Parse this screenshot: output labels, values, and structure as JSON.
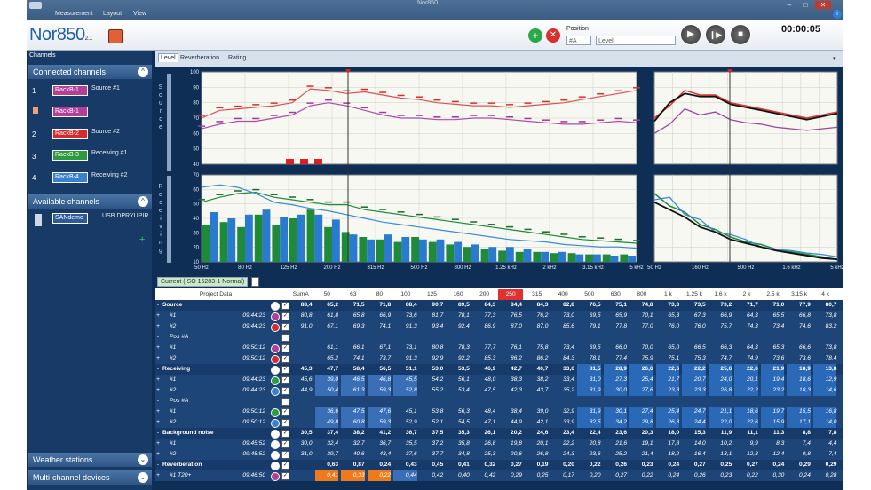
{
  "app": {
    "title": "Nor850",
    "version": "2.1",
    "window_title": "Nor850",
    "menu": [
      "Measurement",
      "Layout",
      "View"
    ],
    "timer": "00:00:05"
  },
  "toolbar": {
    "position_label": "Position",
    "position_value": "#A",
    "level_value": "Level"
  },
  "sidebar": {
    "title": "Channels",
    "connected_header": "Connected channels",
    "channels": [
      {
        "num": "1",
        "chip": "RackB-1",
        "label": "Source #1",
        "color": "#b0409a"
      },
      {
        "num": "",
        "chip": "RackB-1",
        "label": "",
        "color": "#b0409a"
      },
      {
        "num": "2",
        "chip": "RackB-2",
        "label": "Source #2",
        "color": "#d42a2a"
      },
      {
        "num": "3",
        "chip": "RackB-3",
        "label": "Receiving #1",
        "color": "#2e9a3e"
      },
      {
        "num": "4",
        "chip": "RackB-4",
        "label": "Receiving #2",
        "color": "#3a80d0"
      }
    ],
    "available_header": "Available channels",
    "available": [
      {
        "chip": "SANdemo",
        "label": "USB DPRYUPIR"
      }
    ],
    "weather_header": "Weather stations",
    "multi_header": "Multi-channel devices"
  },
  "main_tabs": [
    "Level",
    "Reverberation",
    "Rating"
  ],
  "plots": {
    "source_label": [
      "S",
      "o",
      "u",
      "r",
      "c",
      "e"
    ],
    "receiving_label": [
      "R",
      "e",
      "c",
      "e",
      "i",
      "v",
      "i",
      "n",
      "g"
    ],
    "top_y_ticks": [
      "100",
      "90",
      "80",
      "70",
      "60",
      "50",
      "40"
    ],
    "bottom_y_ticks": [
      "70",
      "60",
      "50",
      "40",
      "30",
      "20",
      "10"
    ],
    "left_x_ticks": [
      "50 Hz",
      "80 Hz",
      "125 Hz",
      "200 Hz",
      "315 Hz",
      "500 Hz",
      "800 Hz",
      "1.25 kHz",
      "2 kHz",
      "3.15 kHz",
      "5 kHz"
    ],
    "right_x_ticks": [
      "50 Hz",
      "160 Hz",
      "500 Hz",
      "1.6 kHz",
      "5 kHz"
    ],
    "source_line_red": [
      70,
      75,
      76,
      77,
      78,
      80,
      89,
      88,
      86,
      87,
      85,
      83,
      82,
      80,
      79,
      78,
      78,
      77,
      78,
      79,
      80,
      82,
      84,
      86,
      88
    ],
    "source_line_purple": [
      63,
      66,
      68,
      68,
      70,
      72,
      78,
      80,
      78,
      75,
      72,
      70,
      70,
      69,
      69,
      70,
      70,
      69,
      68,
      67,
      66,
      66,
      67,
      68,
      67
    ],
    "recv_bars_green": [
      30,
      32,
      28,
      38,
      30,
      35,
      42,
      28,
      24,
      20,
      18,
      16,
      20,
      16,
      14,
      12,
      10,
      9,
      8,
      8,
      7,
      7,
      6,
      6,
      6
    ],
    "recv_bars_blue": [
      40,
      35,
      38,
      42,
      36,
      38,
      38,
      34,
      22,
      18,
      22,
      20,
      18,
      18,
      16,
      14,
      12,
      12,
      10,
      8,
      8,
      6,
      6,
      5,
      5
    ],
    "recv_line_green": [
      48,
      52,
      55,
      56,
      52,
      50,
      48,
      46,
      46,
      42,
      40,
      38,
      36,
      34,
      32,
      30,
      28,
      26,
      24,
      22,
      20,
      18,
      17,
      16,
      15
    ],
    "recv_line_blue": [
      60,
      62,
      60,
      55,
      48,
      46,
      43,
      41,
      38,
      35,
      32,
      30,
      28,
      26,
      24,
      22,
      20,
      18,
      17,
      16,
      14,
      13,
      12,
      12,
      11
    ]
  },
  "table": {
    "tab_label": "Current (ISO 16283-1 Normal)",
    "col_header": "Project Data",
    "freq_headers": [
      "SumA",
      "50",
      "63",
      "80",
      "100",
      "125",
      "160",
      "200",
      "250",
      "315",
      "400",
      "500",
      "630",
      "800",
      "1 k",
      "1.25 k",
      "1.6 k",
      "2 k",
      "2.5 k",
      "3.15 k",
      "4 k",
      "5 k"
    ],
    "rows": [
      {
        "name": "Source",
        "time": "",
        "bold": true,
        "icon": "#ffffff",
        "values": [
          "88,4",
          "65,2",
          "71,5",
          "71,8",
          "88,4",
          "90,7",
          "89,5",
          "84,3",
          "84,4",
          "84,3",
          "82,8",
          "76,5",
          "75,1",
          "74,8",
          "73,3",
          "73,5",
          "73,2",
          "71,7",
          "71,0",
          "77,9",
          "80,7"
        ]
      },
      {
        "name": "#1",
        "time": "09:44:23",
        "bold": false,
        "icon": "#b0409a",
        "values": [
          "80,8",
          "61,8",
          "65,8",
          "66,9",
          "73,6",
          "81,7",
          "78,1",
          "77,3",
          "76,5",
          "76,2",
          "73,0",
          "69,5",
          "65,9",
          "70,1",
          "65,3",
          "67,3",
          "66,9",
          "64,3",
          "65,5",
          "66,8",
          "73,8"
        ]
      },
      {
        "name": "#2",
        "time": "09:44:23",
        "bold": false,
        "icon": "#d42a2a",
        "values": [
          "91,0",
          "67,1",
          "69,3",
          "74,1",
          "91,3",
          "93,4",
          "92,4",
          "86,9",
          "87,0",
          "87,0",
          "85,6",
          "79,1",
          "77,8",
          "77,0",
          "76,0",
          "76,0",
          "75,7",
          "74,3",
          "73,4",
          "74,6",
          "83,2"
        ]
      },
      {
        "name": "Pos #A",
        "time": "",
        "bold": false,
        "icon": "",
        "values": []
      },
      {
        "name": "#1",
        "time": "09:50:12",
        "bold": false,
        "icon": "#b0409a",
        "values": [
          "",
          "61,1",
          "66,1",
          "67,1",
          "73,1",
          "80,8",
          "78,3",
          "77,7",
          "76,1",
          "75,8",
          "73,4",
          "69,5",
          "66,0",
          "70,0",
          "65,0",
          "66,5",
          "66,3",
          "64,3",
          "65,3",
          "66,6",
          "73,8"
        ]
      },
      {
        "name": "#2",
        "time": "09:50:12",
        "bold": false,
        "icon": "#d42a2a",
        "values": [
          "",
          "65,2",
          "74,1",
          "73,7",
          "91,3",
          "92,9",
          "92,2",
          "85,3",
          "86,2",
          "86,2",
          "84,3",
          "78,1",
          "77,4",
          "75,9",
          "75,1",
          "75,3",
          "74,7",
          "74,9",
          "73,6",
          "73,6",
          "78,4"
        ]
      },
      {
        "name": "Receiving",
        "time": "",
        "bold": true,
        "icon": "#ffffff",
        "values": [
          "45,3",
          "47,7",
          "58,4",
          "56,5",
          "51,1",
          "53,0",
          "53,5",
          "46,9",
          "42,7",
          "40,7",
          "33,6",
          "31,5",
          "28,9",
          "26,6",
          "22,6",
          "22,2",
          "25,6",
          "22,6",
          "21,9",
          "18,9",
          "13,8"
        ]
      },
      {
        "name": "#1",
        "time": "09:44:23",
        "bold": false,
        "icon": "#2e9a3e",
        "values": [
          "45,6",
          "39,0",
          "46,5",
          "46,8",
          "45,5",
          "54,2",
          "56,1",
          "48,0",
          "38,3",
          "38,2",
          "33,4",
          "31,0",
          "27,3",
          "25,4",
          "21,7",
          "20,7",
          "24,0",
          "20,1",
          "19,4",
          "18,6",
          "12,9"
        ]
      },
      {
        "name": "#2",
        "time": "09:44:23",
        "bold": false,
        "icon": "#3a80d0",
        "values": [
          "44,9",
          "50,4",
          "61,3",
          "59,3",
          "52,8",
          "55,2",
          "53,4",
          "47,5",
          "42,3",
          "43,7",
          "35,2",
          "31,9",
          "30,0",
          "27,6",
          "23,3",
          "23,3",
          "26,8",
          "22,2",
          "23,2",
          "18,3",
          "14,6"
        ]
      },
      {
        "name": "Pos #A",
        "time": "",
        "bold": false,
        "icon": "",
        "values": []
      },
      {
        "name": "#1",
        "time": "09:50:12",
        "bold": false,
        "icon": "#2e9a3e",
        "values": [
          "",
          "36,6",
          "47,5",
          "47,6",
          "45,1",
          "53,8",
          "56,3",
          "48,4",
          "38,4",
          "39,0",
          "32,9",
          "31,9",
          "30,1",
          "27,4",
          "25,4",
          "24,7",
          "21,1",
          "18,6",
          "19,7",
          "15,5",
          "16,8"
        ]
      },
      {
        "name": "#2",
        "time": "09:50:12",
        "bold": false,
        "icon": "#3a80d0",
        "values": [
          "",
          "49,8",
          "60,8",
          "59,3",
          "52,9",
          "52,1",
          "54,5",
          "47,1",
          "44,9",
          "42,1",
          "33,9",
          "32,5",
          "34,2",
          "29,8",
          "26,3",
          "24,4",
          "22,0",
          "22,6",
          "15,9",
          "17,1",
          "14,0"
        ]
      },
      {
        "name": "Background noise",
        "time": "",
        "bold": true,
        "icon": "#ffffff",
        "values": [
          "30,5",
          "37,4",
          "38,2",
          "41,2",
          "36,7",
          "37,5",
          "35,3",
          "26,1",
          "20,2",
          "24,6",
          "23,4",
          "22,4",
          "23,6",
          "20,3",
          "18,0",
          "15,3",
          "11,9",
          "11,1",
          "11,3",
          "8,8",
          "7,8",
          "6,3"
        ]
      },
      {
        "name": "#1",
        "time": "09:45:52",
        "bold": false,
        "icon": "#ffffff",
        "values": [
          "30,0",
          "32,4",
          "32,7",
          "36,7",
          "35,5",
          "37,2",
          "35,8",
          "26,8",
          "19,8",
          "20,1",
          "22,2",
          "20,8",
          "21,6",
          "19,1",
          "17,8",
          "14,0",
          "10,2",
          "9,9",
          "8,3",
          "7,4",
          "4,4"
        ]
      },
      {
        "name": "#2",
        "time": "09:45:52",
        "bold": false,
        "icon": "#ffffff",
        "values": [
          "31,0",
          "39,7",
          "40,6",
          "43,4",
          "37,6",
          "37,7",
          "34,8",
          "25,3",
          "20,6",
          "26,8",
          "24,3",
          "23,6",
          "25,2",
          "21,4",
          "18,2",
          "16,4",
          "13,1",
          "12,3",
          "12,4",
          "9,8",
          "7,4"
        ]
      },
      {
        "name": "Reverberation",
        "time": "",
        "bold": true,
        "icon": "#ffffff",
        "values": [
          "",
          "0,63",
          "0,87",
          "0,24",
          "0,43",
          "0,45",
          "0,41",
          "0,32",
          "0,27",
          "0,19",
          "0,20",
          "0,22",
          "0,26",
          "0,23",
          "0,24",
          "0,27",
          "0,25",
          "0,27",
          "0,24",
          "0,29",
          "0,29"
        ]
      },
      {
        "name": "#1 T20+",
        "time": "09:46:50",
        "bold": false,
        "icon": "#b0409a",
        "values": [
          "",
          "0,41",
          "0,33",
          "0,22",
          "0,44",
          "0,42",
          "0,40",
          "0,42",
          "0,29",
          "0,25",
          "0,17",
          "0,20",
          "0,27",
          "0,22",
          "0,24",
          "0,26",
          "0,23",
          "0,22",
          "0,30",
          "0,24",
          "0,28"
        ]
      }
    ]
  }
}
